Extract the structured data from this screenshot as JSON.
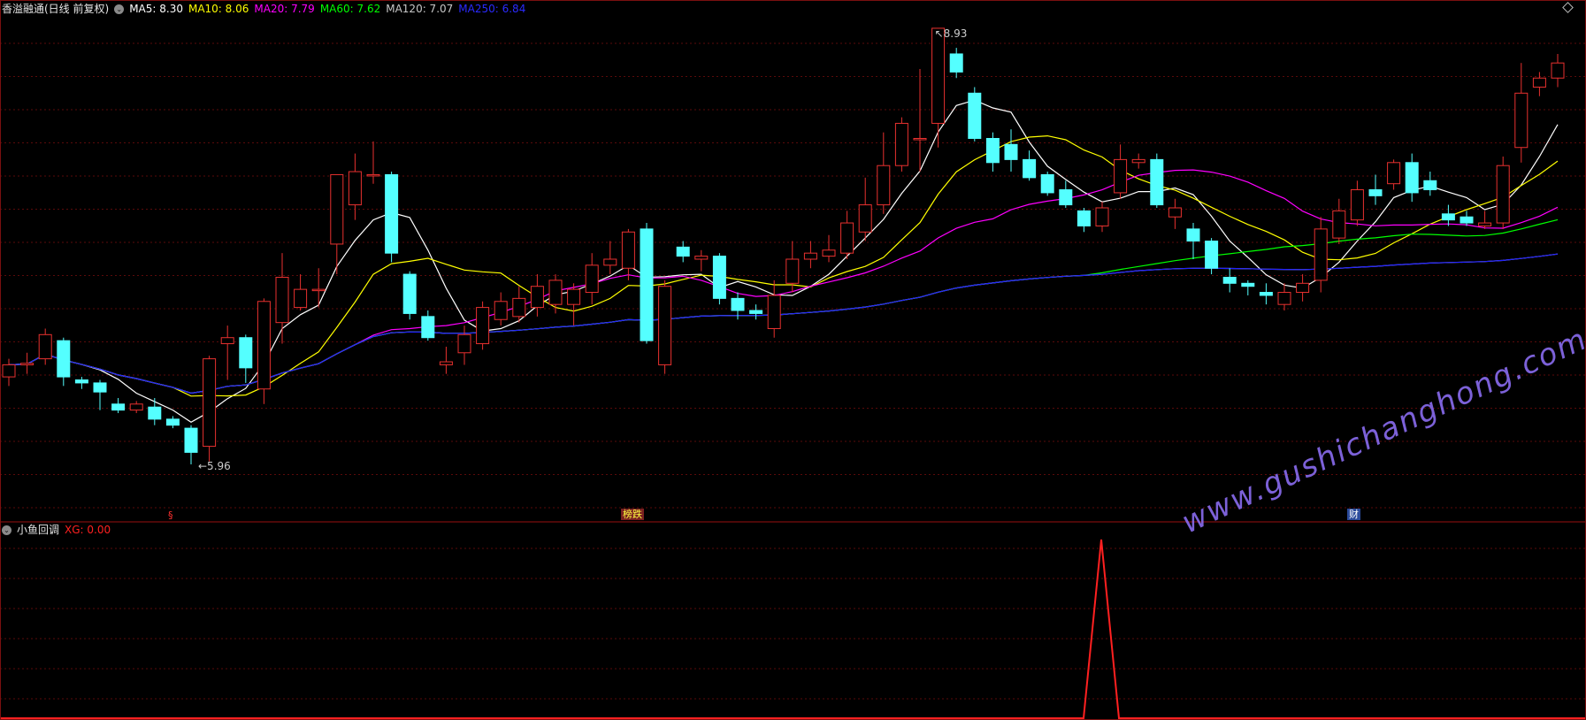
{
  "colors": {
    "background": "#000000",
    "up": "#e8312f",
    "down": "#54ffff",
    "grid": "#5a0a0a",
    "ma5": "#ffffff",
    "ma10": "#ffff00",
    "ma20": "#ff00ff",
    "ma60": "#00ff00",
    "ma120": "#c8c8c8",
    "ma250": "#2020ff",
    "xg": "#ff2020"
  },
  "main_legend": {
    "title": "香溢融通(日线 前复权)",
    "ma5": "MA5: 8.30",
    "ma10": "MA10: 8.06",
    "ma20": "MA20: 7.79",
    "ma60": "MA60: 7.62",
    "ma120": "MA120: 7.07",
    "ma250": "MA250: 6.84"
  },
  "annotations": {
    "high_label": "8.93",
    "low_label": "5.96",
    "tag_left": "§",
    "tag_mid": "榜跌",
    "tag_right": "财"
  },
  "sub_legend": {
    "title": "小鱼回调",
    "xg": "XG: 0.00"
  },
  "watermark": "www.gushichanghong.com",
  "chart_data": {
    "type": "candlestick",
    "price_range": [
      5.8,
      9.0
    ],
    "high": 8.93,
    "low": 5.96,
    "candles": [
      [
        6.62,
        6.7,
        6.56,
        6.74
      ],
      [
        6.7,
        6.71,
        6.64,
        6.78
      ],
      [
        6.74,
        6.9,
        6.7,
        6.94
      ],
      [
        6.86,
        6.62,
        6.56,
        6.88
      ],
      [
        6.6,
        6.58,
        6.54,
        6.62
      ],
      [
        6.58,
        6.52,
        6.4,
        6.6
      ],
      [
        6.44,
        6.4,
        6.38,
        6.48
      ],
      [
        6.4,
        6.44,
        6.38,
        6.46
      ],
      [
        6.42,
        6.34,
        6.3,
        6.48
      ],
      [
        6.34,
        6.3,
        6.28,
        6.36
      ],
      [
        6.28,
        6.12,
        6.04,
        6.3
      ],
      [
        6.16,
        6.74,
        6.06,
        6.76
      ],
      [
        6.84,
        6.88,
        6.6,
        6.96
      ],
      [
        6.88,
        6.68,
        6.58,
        6.9
      ],
      [
        6.54,
        7.12,
        6.44,
        7.14
      ],
      [
        6.98,
        7.28,
        6.84,
        7.44
      ],
      [
        7.08,
        7.2,
        7.06,
        7.3
      ],
      [
        7.2,
        7.2,
        7.08,
        7.34
      ],
      [
        7.5,
        7.96,
        7.3,
        7.96
      ],
      [
        7.76,
        7.98,
        7.66,
        8.1
      ],
      [
        7.96,
        7.96,
        7.9,
        8.18
      ],
      [
        7.96,
        7.44,
        7.38,
        7.98
      ],
      [
        7.3,
        7.04,
        7.0,
        7.32
      ],
      [
        7.02,
        6.88,
        6.86,
        7.06
      ],
      [
        6.7,
        6.72,
        6.64,
        6.82
      ],
      [
        6.78,
        6.9,
        6.7,
        6.96
      ],
      [
        6.84,
        7.08,
        6.8,
        7.12
      ],
      [
        7.0,
        7.12,
        6.96,
        7.18
      ],
      [
        7.02,
        7.14,
        6.98,
        7.22
      ],
      [
        7.08,
        7.22,
        7.02,
        7.3
      ],
      [
        7.1,
        7.26,
        7.04,
        7.3
      ],
      [
        7.1,
        7.2,
        6.96,
        7.24
      ],
      [
        7.18,
        7.36,
        7.1,
        7.44
      ],
      [
        7.36,
        7.4,
        7.3,
        7.52
      ],
      [
        7.34,
        7.58,
        7.26,
        7.6
      ],
      [
        7.6,
        6.86,
        6.84,
        7.64
      ],
      [
        6.7,
        7.22,
        6.64,
        7.26
      ],
      [
        7.48,
        7.42,
        7.38,
        7.52
      ],
      [
        7.4,
        7.42,
        7.32,
        7.46
      ],
      [
        7.42,
        7.14,
        7.1,
        7.44
      ],
      [
        7.14,
        7.06,
        7.0,
        7.18
      ],
      [
        7.06,
        7.04,
        7.0,
        7.1
      ],
      [
        6.94,
        7.16,
        6.88,
        7.26
      ],
      [
        7.24,
        7.4,
        7.18,
        7.52
      ],
      [
        7.4,
        7.44,
        7.34,
        7.52
      ],
      [
        7.42,
        7.46,
        7.38,
        7.56
      ],
      [
        7.44,
        7.64,
        7.4,
        7.72
      ],
      [
        7.58,
        7.76,
        7.52,
        7.94
      ],
      [
        7.76,
        8.02,
        7.7,
        8.24
      ],
      [
        8.02,
        8.3,
        7.98,
        8.34
      ],
      [
        8.2,
        8.2,
        7.98,
        8.66
      ],
      [
        8.3,
        8.93,
        8.14,
        8.93
      ],
      [
        8.76,
        8.64,
        8.6,
        8.8
      ],
      [
        8.5,
        8.2,
        8.18,
        8.54
      ],
      [
        8.2,
        8.04,
        7.98,
        8.24
      ],
      [
        8.16,
        8.06,
        7.98,
        8.26
      ],
      [
        8.06,
        7.94,
        7.92,
        8.12
      ],
      [
        7.96,
        7.84,
        7.82,
        7.98
      ],
      [
        7.86,
        7.76,
        7.74,
        7.92
      ],
      [
        7.72,
        7.62,
        7.58,
        7.74
      ],
      [
        7.62,
        7.74,
        7.58,
        7.78
      ],
      [
        7.84,
        8.06,
        7.8,
        8.16
      ],
      [
        8.04,
        8.06,
        8.0,
        8.1
      ],
      [
        8.06,
        7.76,
        7.74,
        8.1
      ],
      [
        7.68,
        7.74,
        7.6,
        7.8
      ],
      [
        7.6,
        7.52,
        7.4,
        7.64
      ],
      [
        7.52,
        7.34,
        7.3,
        7.54
      ],
      [
        7.28,
        7.24,
        7.18,
        7.34
      ],
      [
        7.24,
        7.22,
        7.16,
        7.26
      ],
      [
        7.18,
        7.16,
        7.1,
        7.24
      ],
      [
        7.1,
        7.18,
        7.06,
        7.24
      ],
      [
        7.18,
        7.24,
        7.12,
        7.3
      ],
      [
        7.26,
        7.6,
        7.18,
        7.68
      ],
      [
        7.54,
        7.72,
        7.5,
        7.8
      ],
      [
        7.66,
        7.86,
        7.62,
        7.92
      ],
      [
        7.86,
        7.82,
        7.76,
        7.96
      ],
      [
        7.9,
        8.04,
        7.86,
        8.06
      ],
      [
        8.04,
        7.84,
        7.78,
        8.1
      ],
      [
        7.92,
        7.86,
        7.82,
        7.98
      ],
      [
        7.7,
        7.66,
        7.62,
        7.76
      ],
      [
        7.68,
        7.64,
        7.62,
        7.72
      ],
      [
        7.62,
        7.64,
        7.6,
        7.72
      ],
      [
        7.64,
        8.02,
        7.6,
        8.08
      ],
      [
        8.14,
        8.5,
        8.04,
        8.7
      ],
      [
        8.54,
        8.6,
        8.48,
        8.64
      ],
      [
        8.6,
        8.7,
        8.54,
        8.76
      ]
    ],
    "indicator_xg": {
      "range": [
        0,
        1
      ],
      "spike_index": 60,
      "spike_value": 1
    }
  }
}
